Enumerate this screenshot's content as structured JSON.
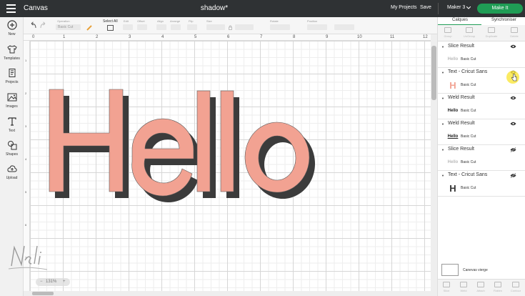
{
  "topbar": {
    "app_title": "Canvas",
    "doc_title": "shadow*",
    "my_projects": "My Projects",
    "save": "Save",
    "machine": "Maker 3",
    "make_it": "Make It"
  },
  "lefttools": [
    {
      "label": "New",
      "icon": "plus-circle-icon"
    },
    {
      "label": "Templates",
      "icon": "shirt-icon"
    },
    {
      "label": "Projects",
      "icon": "projects-icon"
    },
    {
      "label": "Images",
      "icon": "image-icon"
    },
    {
      "label": "Text",
      "icon": "text-icon"
    },
    {
      "label": "Shapes",
      "icon": "shapes-icon"
    },
    {
      "label": "Upload",
      "icon": "upload-cloud-icon"
    }
  ],
  "editbar": {
    "operation_label": "Operation",
    "operation_value": "Basic Cut",
    "select_all": "Select All",
    "edit": "Edit",
    "offset": "Offset",
    "align": "Align",
    "arrange": "Arrange",
    "flip": "Flip",
    "size": "Size",
    "rotate": "Rotate",
    "position": "Position"
  },
  "canvas": {
    "ruler_top": [
      "0",
      "1",
      "2",
      "3",
      "4",
      "5",
      "6",
      "7",
      "8",
      "9",
      "10",
      "11",
      "12"
    ],
    "ruler_left": [
      "1",
      "2",
      "3",
      "4",
      "5",
      "6",
      "7"
    ],
    "hello_text": "Hello",
    "zoom": "131%",
    "signature": "Neli",
    "colors": {
      "fill": "#f2a292",
      "shadow": "#3b3b3b"
    }
  },
  "panel": {
    "tabs": [
      "Calques",
      "Synchroniser"
    ],
    "actions": [
      "Group",
      "UnGroup",
      "Duplicate",
      "Delete"
    ],
    "layers": [
      {
        "name": "Slice Result",
        "thumb": "Hello",
        "sub": "Basic Cut",
        "visible": true
      },
      {
        "name": "Text - Cricut Sans",
        "thumb": "H",
        "sub": "Basic Cut",
        "visible": true
      },
      {
        "name": "Weld Result",
        "thumb": "Hello",
        "sub": "Basic Cut",
        "visible": true
      },
      {
        "name": "Weld Result",
        "thumb": "Hello",
        "sub": "Basic Cut",
        "visible": true
      },
      {
        "name": "Slice Result",
        "thumb": "Hello",
        "sub": "Basic Cut",
        "visible": false
      },
      {
        "name": "Text - Cricut Sans",
        "thumb": "H",
        "sub": "Basic Cut",
        "visible": false
      }
    ],
    "blank_canvas": "Canevas vierge",
    "bottom_actions": [
      "Slice",
      "Weld",
      "Attach",
      "Flatten",
      "Contour"
    ]
  }
}
